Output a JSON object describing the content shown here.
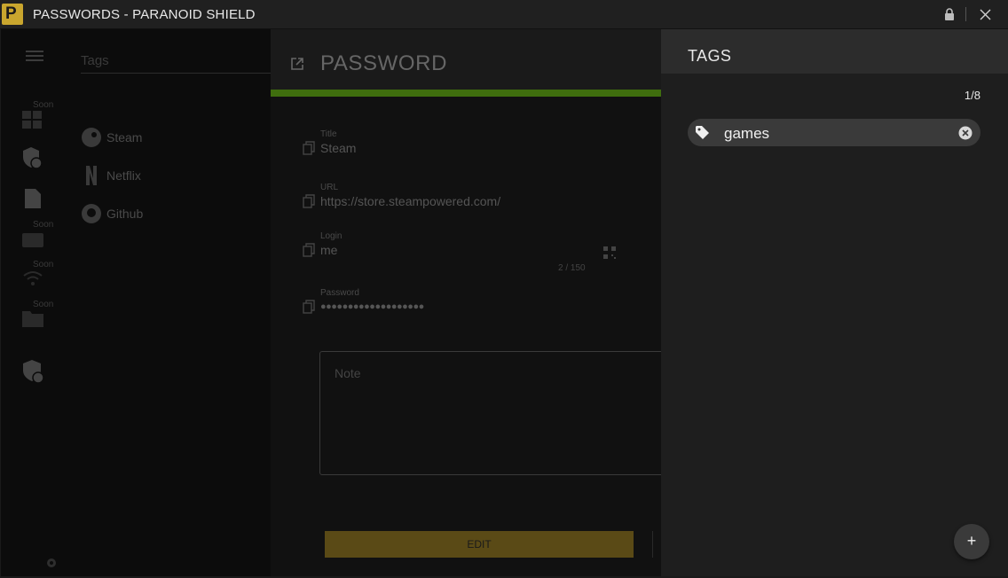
{
  "window": {
    "logo_letter": "P",
    "title": "PASSWORDS - PARANOID SHIELD"
  },
  "rail": {
    "soon_labels": [
      "Soon",
      "Soon",
      "Soon",
      "Soon"
    ]
  },
  "list": {
    "search_placeholder": "Tags",
    "entries": [
      {
        "label": "Steam",
        "icon": "steam-icon"
      },
      {
        "label": "Netflix",
        "icon": "netflix-icon"
      },
      {
        "label": "Github",
        "icon": "github-icon"
      }
    ]
  },
  "detail": {
    "heading": "PASSWORD",
    "strength_color": "#3f6e0e",
    "fields": [
      {
        "label": "Title",
        "value": "Steam"
      },
      {
        "label": "URL",
        "value": "https://store.steampowered.com/"
      },
      {
        "label": "Login",
        "value": "me"
      },
      {
        "label": "Password",
        "value": "●●●●●●●●●●●●●●●●●●●"
      }
    ],
    "login_counter": "2 / 150",
    "note_placeholder": "Note",
    "edit_label": "EDIT"
  },
  "tags_panel": {
    "title": "TAGS",
    "count": "1/8",
    "tags": [
      {
        "label": "games"
      }
    ],
    "add_label": "+"
  },
  "colors": {
    "accent": "#c9a62e",
    "panel_bg": "#1e1e1e",
    "chip_bg": "#3a3a3a"
  }
}
